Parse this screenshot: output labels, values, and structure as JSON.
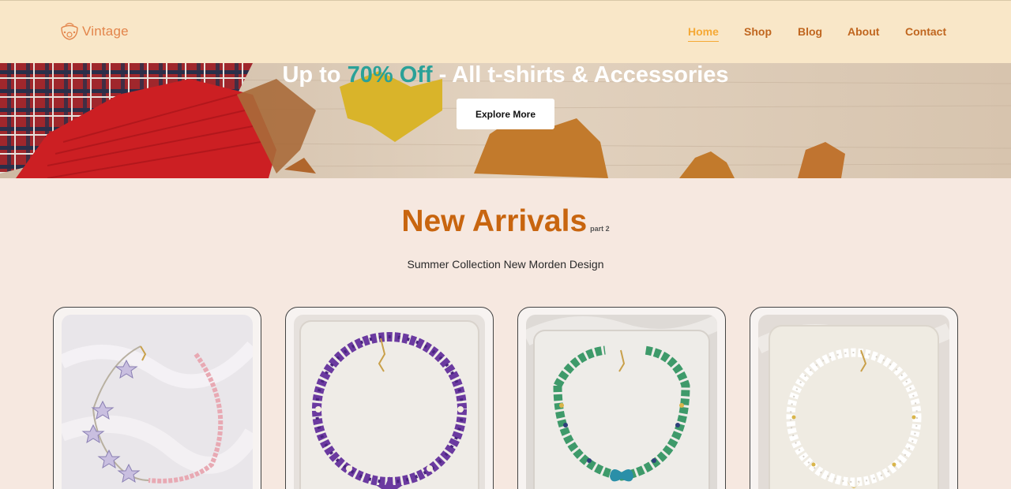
{
  "header": {
    "logo_text": "Vintage",
    "nav": [
      {
        "label": "Home",
        "active": true
      },
      {
        "label": "Shop",
        "active": false
      },
      {
        "label": "Blog",
        "active": false
      },
      {
        "label": "About",
        "active": false
      },
      {
        "label": "Contact",
        "active": false
      }
    ]
  },
  "hero": {
    "title_prefix": "Up to ",
    "title_accent": "70% Off",
    "title_suffix": " - All t-shirts & Accessories",
    "button_label": "Explore More"
  },
  "section": {
    "title": "New Arrivals",
    "title_suffix": "part 2",
    "subtitle": "Summer Collection New Morden Design"
  },
  "products": [
    {
      "image": "pink-pearl-star-necklace"
    },
    {
      "image": "purple-amethyst-chip-necklace"
    },
    {
      "image": "green-aventurine-butterfly-necklace"
    },
    {
      "image": "white-moonstone-crescent-necklace"
    }
  ],
  "colors": {
    "header_bg": "#f9e7c8",
    "nav_text": "#c0661f",
    "nav_active": "#f5a936",
    "accent": "#2aa198",
    "title": "#c8650f",
    "page_bg": "#f6e8e0"
  }
}
